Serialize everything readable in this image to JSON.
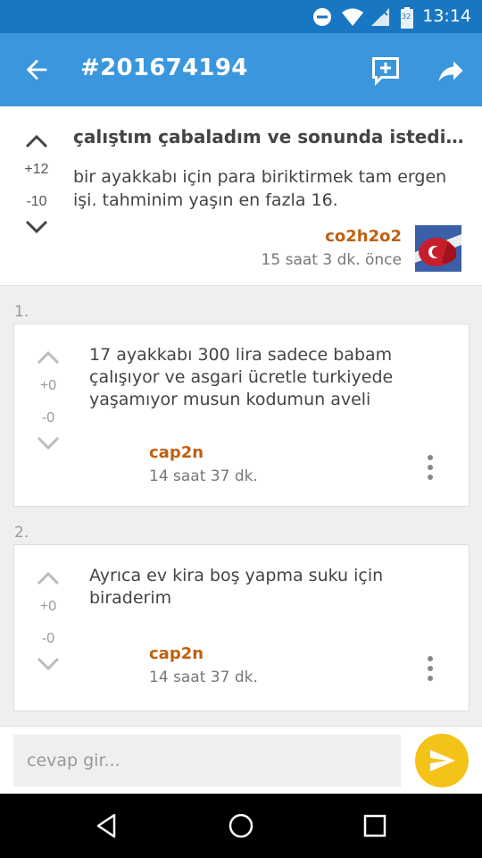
{
  "status_bar": {
    "time": "13:14",
    "battery_level": "32"
  },
  "app_bar": {
    "title": "#201674194"
  },
  "entry": {
    "title": "çalıştım çabaladım ve sonunda istediğim ayakkabıyı aldım",
    "body": "bir ayakkabı için para biriktirmek tam ergen işi. tahminim yaşın en fazla 16.",
    "upvotes": "+12",
    "downvotes": "-10",
    "author": "co2h2o2",
    "time": "15 saat 3 dk. önce"
  },
  "comments": [
    {
      "number": "1.",
      "text": "17 ayakkabı 300 lira sadece babam çalışıyor ve asgari ücretle turkiyede yaşamıyor musun kodumun aveli",
      "upvotes": "+0",
      "downvotes": "-0",
      "author": "cap2n",
      "time": "14 saat 37 dk."
    },
    {
      "number": "2.",
      "text": "Ayrıca ev kira boş yapma suku için biraderim",
      "upvotes": "+0",
      "downvotes": "-0",
      "author": "cap2n",
      "time": "14 saat 37 dk."
    }
  ],
  "reply_bar": {
    "placeholder": "cevap gir..."
  },
  "colors": {
    "status_bar": "#1976c2",
    "app_bar": "#3a97dd",
    "author": "#c06010",
    "send_button": "#f4c318"
  },
  "icons": [
    "dnd-icon",
    "wifi-icon",
    "signal-icon",
    "battery-icon",
    "back-arrow-icon",
    "add-comment-icon",
    "share-icon",
    "upvote-icon",
    "downvote-icon",
    "more-vert-icon",
    "send-icon",
    "nav-back-icon",
    "nav-home-icon",
    "nav-recents-icon"
  ]
}
